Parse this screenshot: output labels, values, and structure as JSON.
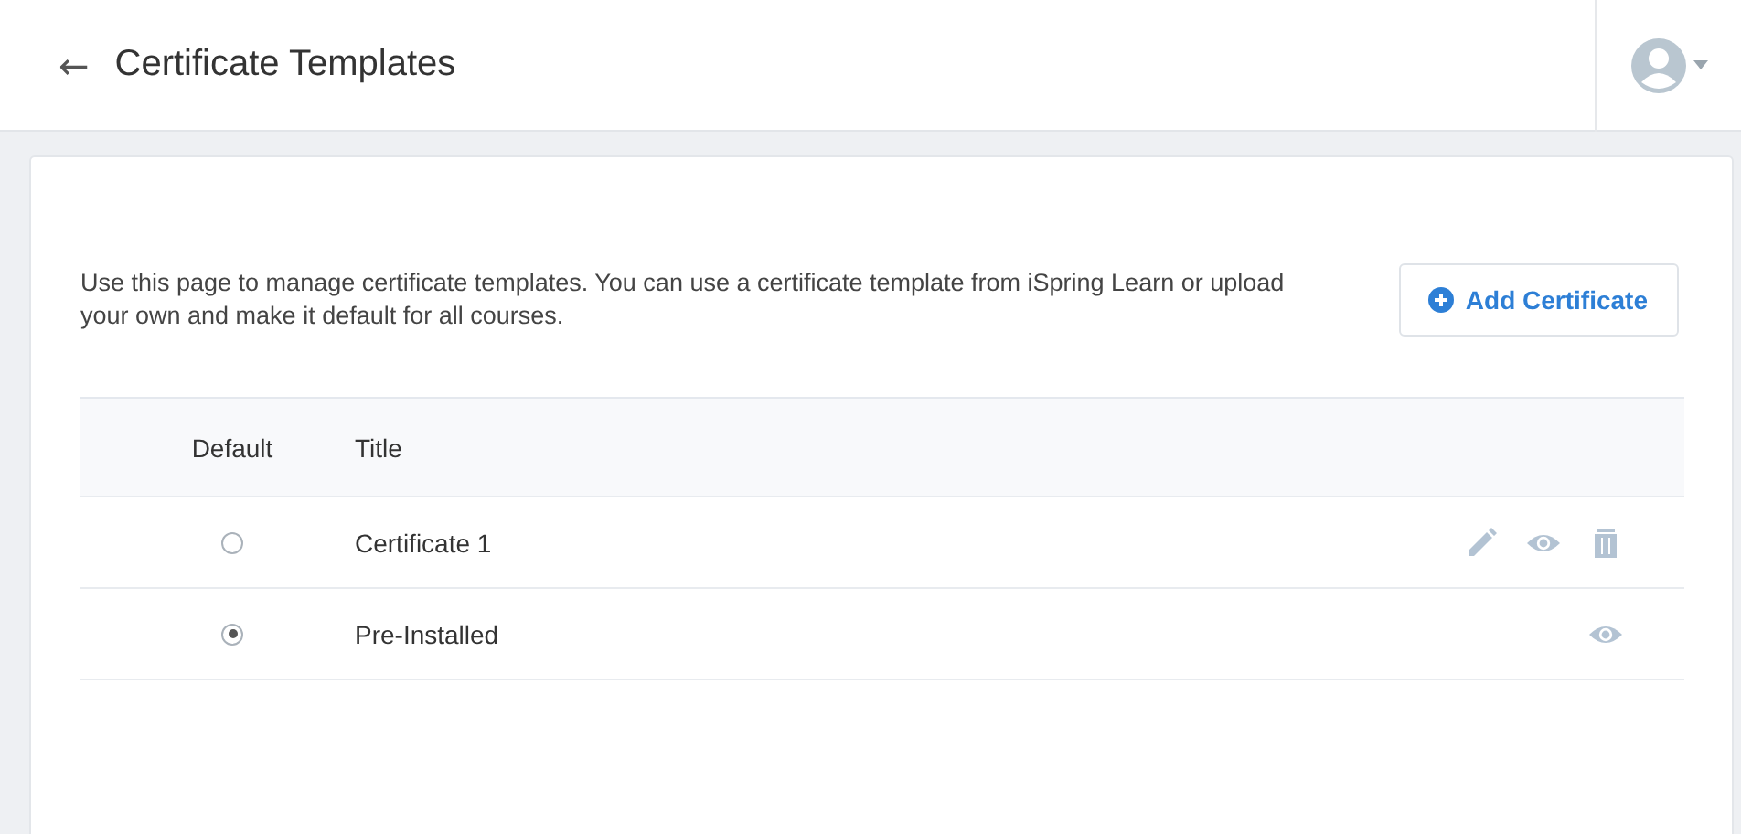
{
  "header": {
    "back": "←",
    "title": "Certificate Templates"
  },
  "intro": "Use this page to manage certificate templates. You can use a certificate template from iSpring Learn or upload your own and make it default for all courses.",
  "add_button": "Add Certificate",
  "table": {
    "columns": [
      "Default",
      "Title"
    ],
    "rows": [
      {
        "selected": false,
        "title": "Certificate 1",
        "actions": [
          {
            "kind": "edit"
          },
          {
            "kind": "view"
          },
          {
            "kind": "delete"
          }
        ]
      },
      {
        "selected": true,
        "title": "Pre-Installed",
        "actions": [
          {
            "kind": "view"
          }
        ]
      }
    ]
  }
}
